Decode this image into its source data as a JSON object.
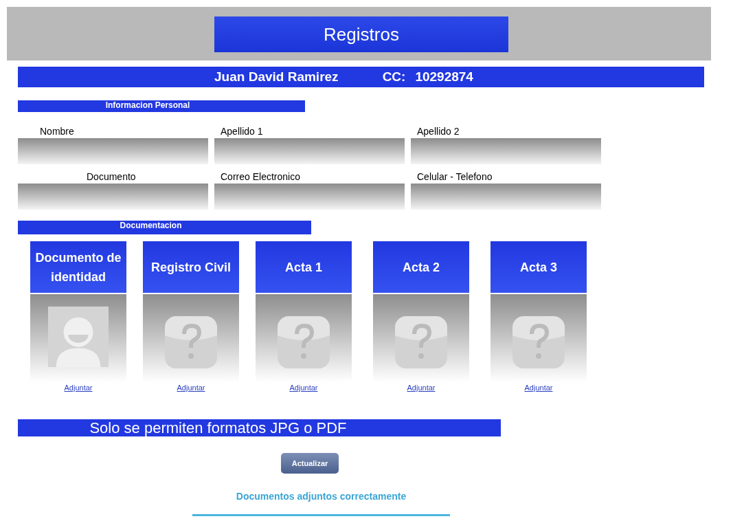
{
  "header": {
    "title": "Registros"
  },
  "person": {
    "name": "Juan David Ramirez",
    "id_label": "CC:",
    "id_number": "10292874"
  },
  "personal_section": {
    "title": "Informacion Personal"
  },
  "fields": [
    {
      "label": "Nombre"
    },
    {
      "label": "Apellido 1"
    },
    {
      "label": "Apellido 2"
    },
    {
      "label": "Documento"
    },
    {
      "label": "Correo Electronico"
    },
    {
      "label": "Celular - Telefono"
    }
  ],
  "documents_section": {
    "title": "Documentacion"
  },
  "documents": [
    {
      "title": "Documento de identidad",
      "kind": "person",
      "link": "Adjuntar"
    },
    {
      "title": "Registro Civil",
      "kind": "unknown",
      "link": "Adjuntar"
    },
    {
      "title": "Acta 1",
      "kind": "unknown",
      "link": "Adjuntar"
    },
    {
      "title": "Acta 2",
      "kind": "unknown",
      "link": "Adjuntar"
    },
    {
      "title": "Acta 3",
      "kind": "unknown",
      "link": "Adjuntar"
    }
  ],
  "formats_notice": "Solo se permiten formatos JPG o PDF",
  "button": "Actualizar",
  "message": "Documentos adjuntos correctamente"
}
